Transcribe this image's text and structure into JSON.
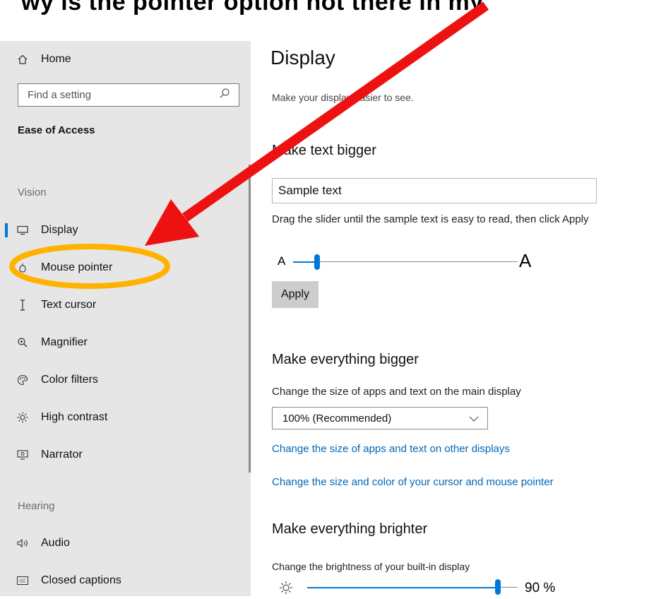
{
  "caption": "wy is the pointer option not there in my",
  "sidebar": {
    "home_label": "Home",
    "search_placeholder": "Find a setting",
    "section_title": "Ease of Access",
    "vision_label": "Vision",
    "hearing_label": "Hearing",
    "items": [
      {
        "label": "Display",
        "icon": "monitor-icon",
        "active": true
      },
      {
        "label": "Mouse pointer",
        "icon": "mouse-pointer-icon"
      },
      {
        "label": "Text cursor",
        "icon": "text-cursor-icon"
      },
      {
        "label": "Magnifier",
        "icon": "magnifier-icon"
      },
      {
        "label": "Color filters",
        "icon": "palette-icon"
      },
      {
        "label": "High contrast",
        "icon": "sun-icon"
      },
      {
        "label": "Narrator",
        "icon": "narrator-icon"
      },
      {
        "label": "Audio",
        "icon": "speaker-icon"
      },
      {
        "label": "Closed captions",
        "icon": "cc-icon"
      }
    ]
  },
  "main": {
    "title": "Display",
    "subtitle": "Make your display easier to see.",
    "text_bigger": {
      "heading": "Make text bigger",
      "sample": "Sample text",
      "instructions": "Drag the slider until the sample text is easy to read, then click Apply",
      "slider_min_label": "A",
      "slider_max_label": "A",
      "slider_value_fraction": 0.1,
      "apply_label": "Apply"
    },
    "everything_bigger": {
      "heading": "Make everything bigger",
      "description": "Change the size of apps and text on the main display",
      "dropdown_value": "100% (Recommended)",
      "link_other_displays": "Change the size of apps and text on other displays",
      "link_cursor": "Change the size and color of your cursor and mouse pointer"
    },
    "brighter": {
      "heading": "Make everything brighter",
      "description": "Change the brightness of your built-in display",
      "value_percent": 90,
      "value_label": "90 %"
    }
  },
  "annotations": {
    "arrow_color": "#ee1111",
    "highlight_color": "#ffb300"
  },
  "colors": {
    "accent": "#0078d7",
    "link": "#0067b8",
    "sidebar_bg": "#e6e6e6"
  }
}
